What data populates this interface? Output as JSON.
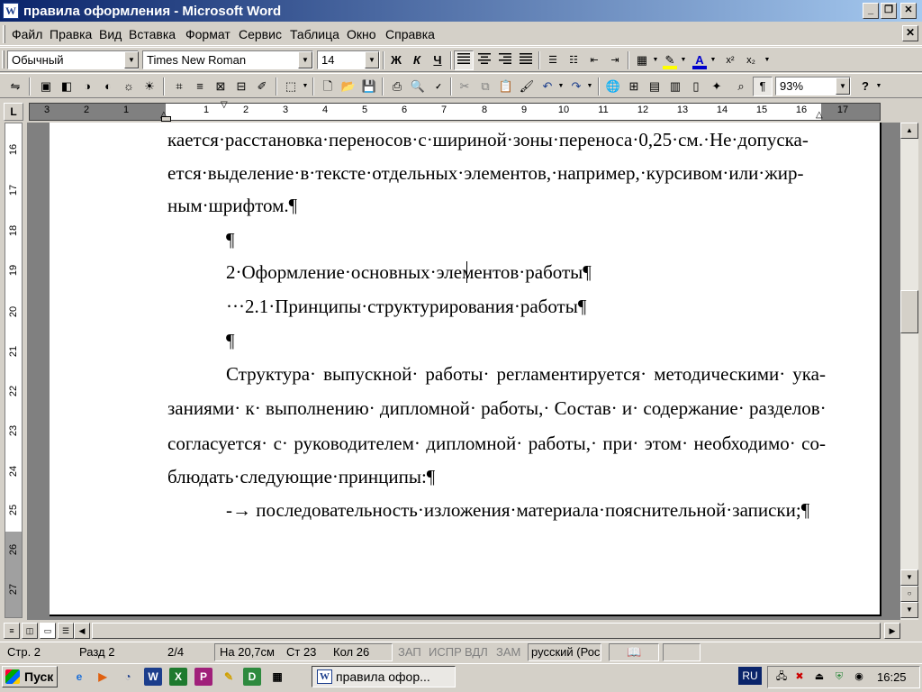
{
  "window": {
    "title": "правила оформления - Microsoft Word",
    "icon": "word-doc-icon",
    "icon_glyph": "W",
    "minimize_glyph": "_",
    "maximize_glyph": "❐",
    "close_glyph": "✕"
  },
  "menu": {
    "items": [
      "Файл",
      "Правка",
      "Вид",
      "Вставка",
      "Формат",
      "Сервис",
      "Таблица",
      "Окно",
      "Справка"
    ],
    "close_glyph": "✕"
  },
  "formatting_toolbar": {
    "style": "Обычный",
    "font": "Times New Roman",
    "size": "14",
    "bold": "Ж",
    "italic": "К",
    "underline": "Ч",
    "active_alignment": "justify",
    "highlight_color": "#ffff00",
    "font_color": "#0000cc",
    "font_color_glyph": "A",
    "superscript_glyph": "x²",
    "subscript_glyph": "x₂"
  },
  "standard_toolbar": {
    "show_formatting_marks_glyph": "¶",
    "zoom": "93%",
    "help_glyph": "?"
  },
  "ruler": {
    "corner_glyph": "L",
    "numbers": [
      "3",
      "2",
      "1",
      "1",
      "2",
      "3",
      "4",
      "5",
      "6",
      "7",
      "8",
      "9",
      "10",
      "11",
      "12",
      "13",
      "14",
      "15",
      "16",
      "17"
    ],
    "vertical_numbers": [
      "16",
      "17",
      "18",
      "19",
      "20",
      "21",
      "22",
      "23",
      "24",
      "25",
      "26",
      "27"
    ]
  },
  "document": {
    "lines": [
      "кается·расстановка·переносов·с·шириной·зоны·переноса·0,25·см.·Не·допуска-",
      "ется·выделение·в·тексте·отдельных·элементов,·например,·курсивом·или·жир-",
      "ным·шрифтом.¶",
      "¶",
      "2·Оформление·основных·элементов·работы¶",
      "···2.1·Принципы·структурирования·работы¶",
      "¶",
      "Структура· выпускной· работы· регламентируется· методическими· ука-",
      "заниями· к· выполнению· дипломной· работы,· Состав· и· содержание· разделов·",
      "согласуется· с· руководителем· дипломной· работы,· при· этом· необходимо· со-",
      "блюдать·следующие·принципы:¶",
      "-→ последовательность·изложения·материала·пояснительной·записки;¶"
    ]
  },
  "status": {
    "page": "Стр. 2",
    "section": "Разд 2",
    "pages": "2/4",
    "position": "На 20,7см",
    "line": "Ст 23",
    "column": "Кол 26",
    "rec": "ЗАП",
    "trk": "ИСПР",
    "ext": "ВДЛ",
    "ovr": "ЗАМ",
    "language": "русский (Рос"
  },
  "taskbar": {
    "start": "Пуск",
    "task_label": "правила офор...",
    "language": "RU",
    "clock": "16:25"
  }
}
